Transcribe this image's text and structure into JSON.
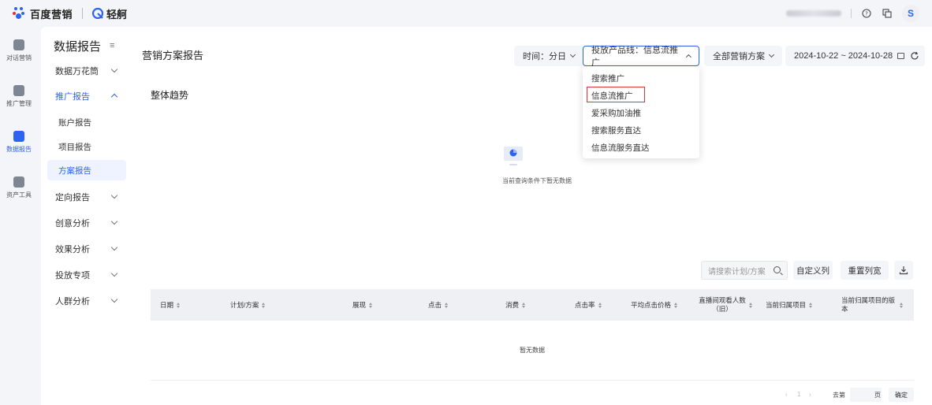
{
  "brand": {
    "name": "百度营销",
    "sub": "轻舸",
    "accent": "#2d63f0"
  },
  "topbar": {
    "avatar": "S",
    "help_icon": "help-icon",
    "copy_icon": "copy-icon"
  },
  "rail": [
    {
      "label": "对话营销",
      "icon": "chat-marketing-icon"
    },
    {
      "label": "推广管理",
      "icon": "monitor-icon"
    },
    {
      "label": "数据报告",
      "icon": "report-icon",
      "active": true
    },
    {
      "label": "资产工具",
      "icon": "toolbox-icon"
    }
  ],
  "nav": {
    "title": "数据报告",
    "items": [
      {
        "label": "数据万花筒"
      },
      {
        "label": "推广报告",
        "open": true,
        "children": [
          "账户报告",
          "项目报告",
          "方案报告"
        ]
      },
      {
        "label": "定向报告"
      },
      {
        "label": "创意分析"
      },
      {
        "label": "效果分析"
      },
      {
        "label": "投放专项"
      },
      {
        "label": "人群分析"
      }
    ],
    "active_child": "方案报告"
  },
  "page": {
    "title": "营销方案报告",
    "filters": {
      "time": "时间：分日",
      "product_line": "投放产品线：信息流推广",
      "plan": "全部营销方案",
      "date_range": "2024-10-22 ~ 2024-10-28"
    },
    "trend_title": "整体趋势",
    "empty_query": "当前查询条件下暂无数据"
  },
  "dropdown": {
    "options": [
      "搜索推广",
      "信息流推广",
      "爱采购加油推",
      "搜索服务直达",
      "信息流服务直达"
    ],
    "selected": "信息流推广"
  },
  "table": {
    "search_placeholder": "请搜索计划/方案",
    "customize_cols": "自定义列",
    "reset_width": "重置列宽",
    "columns": [
      "日期",
      "计划/方案",
      "展现",
      "点击",
      "消费",
      "点击率",
      "平均点击价格",
      "直播间观看人数（旧）",
      "当前归属项目",
      "当前归属项目的版本"
    ],
    "empty": "暂无数据"
  },
  "pagination": {
    "prev": "‹",
    "page": "1",
    "next": "›",
    "goto": "去第",
    "page_unit": "页",
    "confirm": "确定"
  }
}
